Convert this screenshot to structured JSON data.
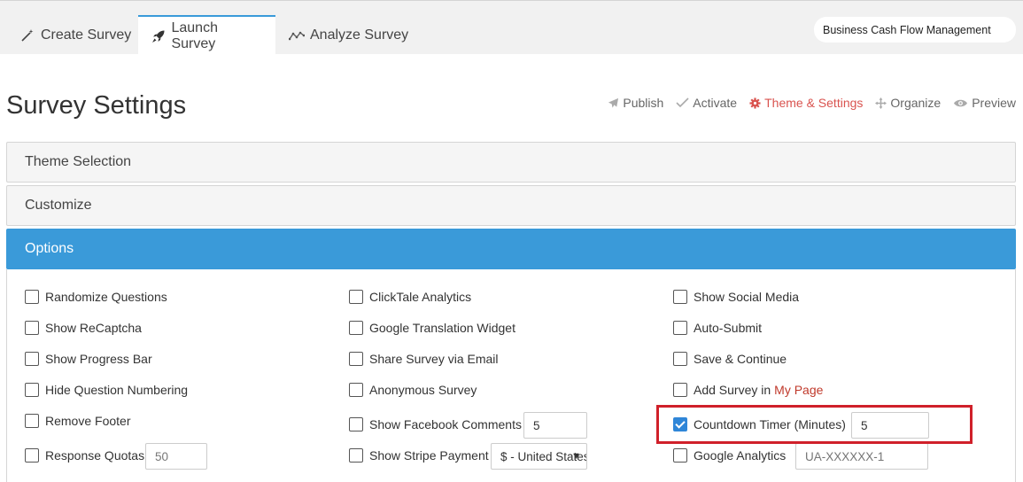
{
  "tabs": {
    "create": "Create Survey",
    "launch": "Launch Survey",
    "analyze": "Analyze Survey"
  },
  "survey_name": "Business Cash Flow Management",
  "page_title": "Survey Settings",
  "steps": {
    "publish": "Publish",
    "activate": "Activate",
    "theme": "Theme & Settings",
    "organize": "Organize",
    "preview": "Preview"
  },
  "panels": {
    "theme_selection": "Theme Selection",
    "customize": "Customize",
    "options": "Options"
  },
  "options": {
    "randomize_questions": "Randomize Questions",
    "show_recaptcha": "Show ReCaptcha",
    "show_progress_bar": "Show Progress Bar",
    "hide_question_numbering": "Hide Question Numbering",
    "remove_footer": "Remove Footer",
    "response_quotas": "Response Quotas",
    "response_quotas_value": "50",
    "clicktale_analytics": "ClickTale Analytics",
    "google_translation_widget": "Google Translation Widget",
    "share_survey_via_email": "Share Survey via Email",
    "anonymous_survey": "Anonymous Survey",
    "show_facebook_comments": "Show Facebook Comments",
    "facebook_comments_value": "5",
    "show_stripe_payment": "Show Stripe Payment",
    "stripe_currency": "$ - United States",
    "show_social_media": "Show Social Media",
    "auto_submit": "Auto-Submit",
    "save_continue": "Save & Continue",
    "add_survey_in": "Add Survey in",
    "my_page": "My Page",
    "countdown_timer": "Countdown Timer (Minutes)",
    "countdown_timer_value": "5",
    "google_analytics": "Google Analytics",
    "google_analytics_placeholder": "UA-XXXXXX-1"
  },
  "colors": {
    "accent": "#3a9ad9",
    "active_step": "#d9534f",
    "highlight": "#d0202a"
  }
}
